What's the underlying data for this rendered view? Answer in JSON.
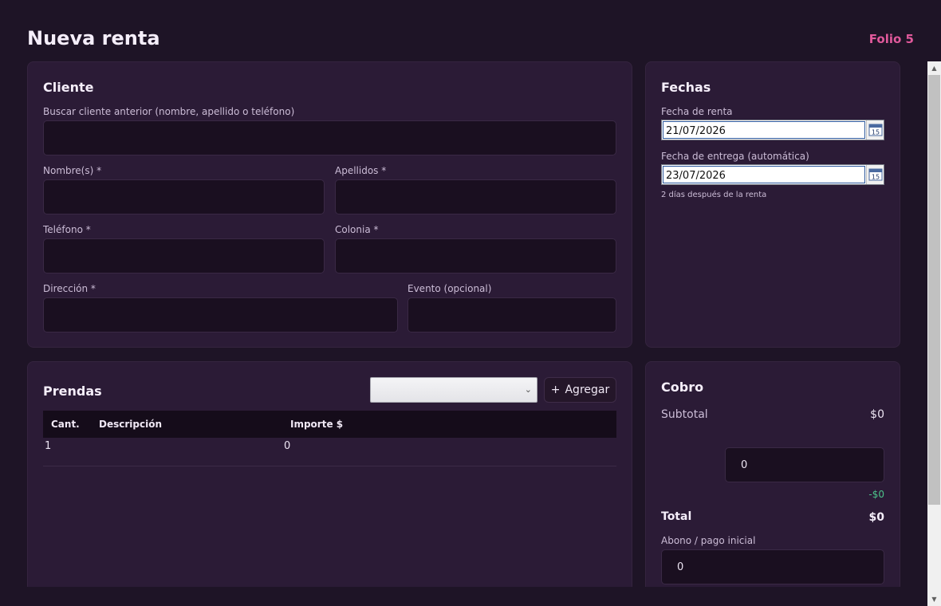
{
  "header": {
    "title": "Nueva renta",
    "folio": "Folio 5"
  },
  "cliente": {
    "title": "Cliente",
    "search": {
      "label": "Buscar cliente anterior (nombre, apellido o teléfono)",
      "value": ""
    },
    "nombres": {
      "label": "Nombre(s) *",
      "value": ""
    },
    "apellidos": {
      "label": "Apellidos *",
      "value": ""
    },
    "telefono": {
      "label": "Teléfono *",
      "value": ""
    },
    "colonia": {
      "label": "Colonia *",
      "value": ""
    },
    "direccion": {
      "label": "Dirección *",
      "value": ""
    },
    "evento": {
      "label": "Evento (opcional)",
      "value": ""
    }
  },
  "fechas": {
    "title": "Fechas",
    "renta": {
      "label": "Fecha de renta",
      "value": "21/07/2026"
    },
    "entrega": {
      "label": "Fecha de entrega (automática)",
      "value": "23/07/2026"
    },
    "hint": "2 días después de la renta",
    "calendar_day": "15"
  },
  "prendas": {
    "title": "Prendas",
    "select_value": "",
    "add_label": "Agregar",
    "columns": [
      "Cant.",
      "Descripción",
      "Importe $"
    ],
    "rows": [
      {
        "cant": "1",
        "descripcion": "",
        "importe": "0"
      }
    ]
  },
  "cobro": {
    "title": "Cobro",
    "subtotal_label": "Subtotal",
    "subtotal_value": "$0",
    "discount_input": "0",
    "discount_value": "-$0",
    "total_label": "Total",
    "total_value": "$0",
    "abono_label": "Abono / pago inicial",
    "abono_value": "0"
  },
  "colors": {
    "accent": "#e0599b",
    "positive": "#4cc38a",
    "card": "#2b1b36",
    "background": "#1e1426"
  }
}
